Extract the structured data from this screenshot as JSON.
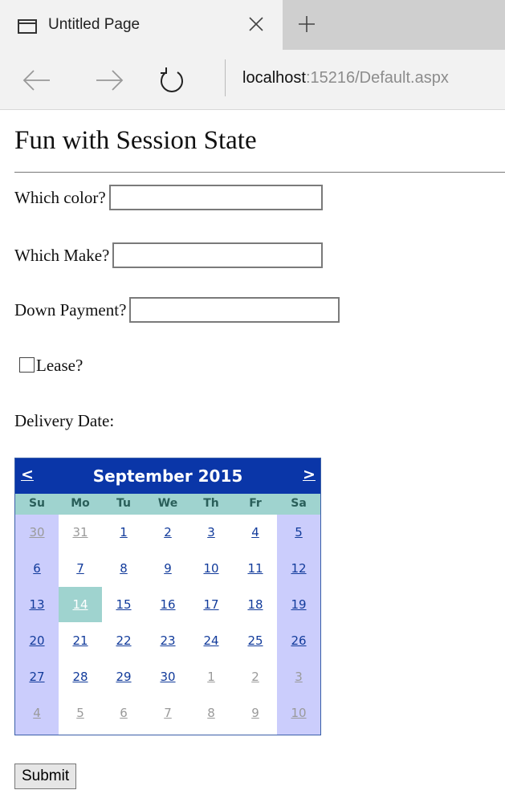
{
  "browser": {
    "tab_title": "Untitled Page",
    "url_host": "localhost",
    "url_rest": ":15216/Default.aspx",
    "icons": [
      "page-icon",
      "close-icon",
      "plus-icon",
      "back-arrow-icon",
      "forward-arrow-icon",
      "refresh-icon"
    ]
  },
  "page": {
    "title": "Fun with Session State",
    "color_label": "Which color?",
    "make_label": "Which Make?",
    "payment_label": "Down Payment?",
    "lease_label": "Lease?",
    "lease_checked": false,
    "delivery_label": "Delivery Date:",
    "submit_label": "Submit"
  },
  "calendar": {
    "prev": "<",
    "next": ">",
    "month": "September 2015",
    "days_of_week": [
      "Su",
      "Mo",
      "Tu",
      "We",
      "Th",
      "Fr",
      "Sa"
    ],
    "weeks": [
      [
        "30",
        "31",
        "1",
        "2",
        "3",
        "4",
        "5"
      ],
      [
        "6",
        "7",
        "8",
        "9",
        "10",
        "11",
        "12"
      ],
      [
        "13",
        "14",
        "15",
        "16",
        "17",
        "18",
        "19"
      ],
      [
        "20",
        "21",
        "22",
        "23",
        "24",
        "25",
        "26"
      ],
      [
        "27",
        "28",
        "29",
        "30",
        "1",
        "2",
        "3"
      ],
      [
        "4",
        "5",
        "6",
        "7",
        "8",
        "9",
        "10"
      ]
    ],
    "other_month": [
      [
        true,
        true,
        false,
        false,
        false,
        false,
        false
      ],
      [
        false,
        false,
        false,
        false,
        false,
        false,
        false
      ],
      [
        false,
        false,
        false,
        false,
        false,
        false,
        false
      ],
      [
        false,
        false,
        false,
        false,
        false,
        false,
        false
      ],
      [
        false,
        false,
        false,
        false,
        true,
        true,
        true
      ],
      [
        true,
        true,
        true,
        true,
        true,
        true,
        true
      ]
    ],
    "selected": "14",
    "colors": {
      "header": "#0a36a8",
      "day_header": "#9fd3cf",
      "weekend": "#cbcdfc",
      "selected": "#9fd3cf",
      "link": "#123b9b",
      "other_month": "#9a9a9a"
    }
  }
}
